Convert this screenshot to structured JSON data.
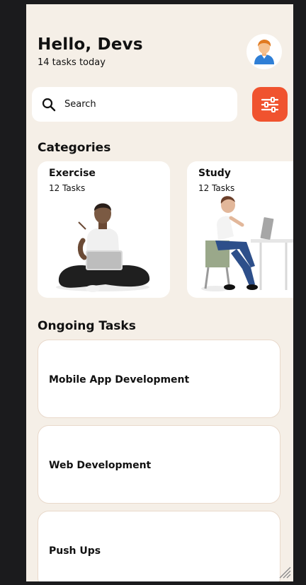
{
  "header": {
    "greeting": "Hello, Devs",
    "subtitle": "14 tasks today",
    "avatar_icon": "user-avatar-icon"
  },
  "search": {
    "text": "Search",
    "icon": "search-icon"
  },
  "filter": {
    "icon": "sliders-icon",
    "color": "#f0532f"
  },
  "categories": {
    "title": "Categories",
    "items": [
      {
        "name": "Exercise",
        "count": "12 Tasks"
      },
      {
        "name": "Study",
        "count": "12 Tasks"
      }
    ]
  },
  "ongoing": {
    "title": "Ongoing Tasks",
    "items": [
      {
        "title": "Mobile App Development"
      },
      {
        "title": "Web Development"
      },
      {
        "title": "Push Ups"
      }
    ]
  },
  "colors": {
    "background": "#f5efe7",
    "card": "#ffffff",
    "accent": "#f0532f"
  }
}
